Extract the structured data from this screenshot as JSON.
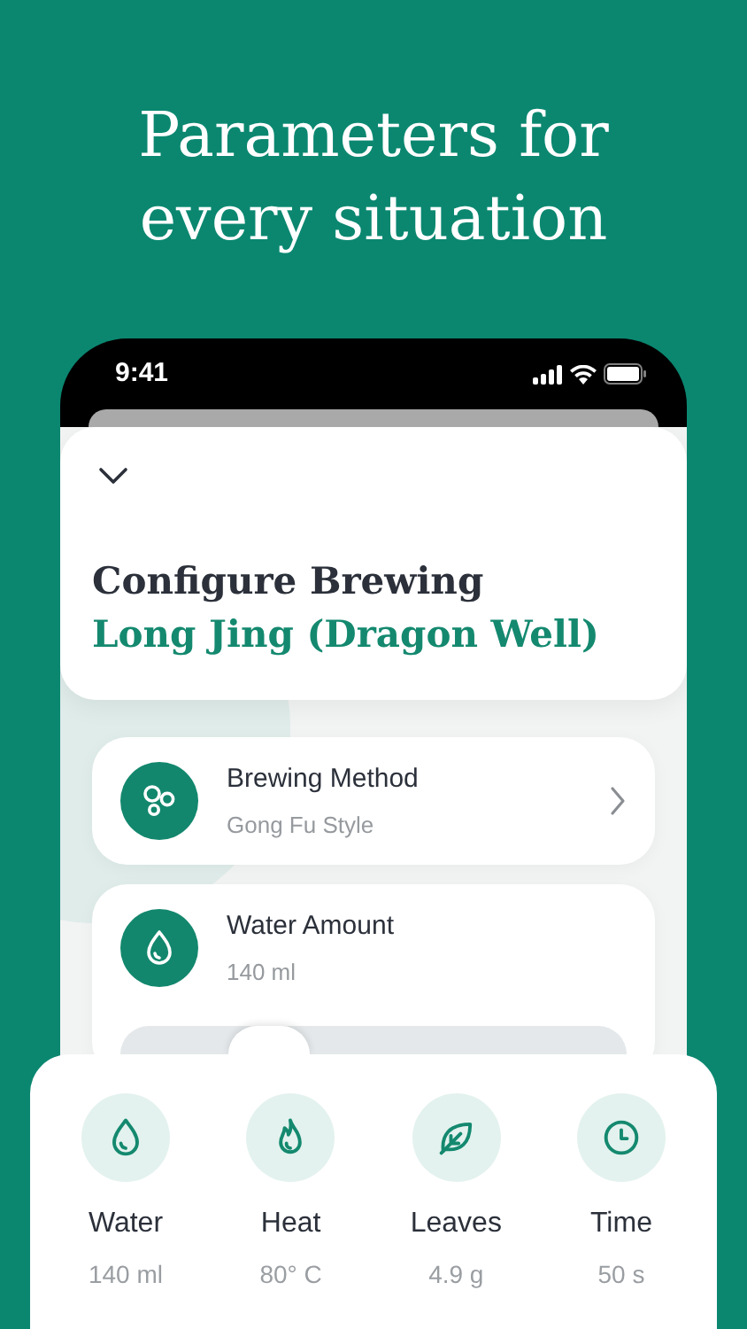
{
  "headline": "Parameters for every situation",
  "status_bar": {
    "time": "9:41"
  },
  "header": {
    "title": "Configure Brewing",
    "subtitle": "Long Jing (Dragon Well)"
  },
  "settings": [
    {
      "kind": "method",
      "label": "Brewing Method",
      "value": "Gong Fu Style",
      "chevron": true
    },
    {
      "kind": "water",
      "label": "Water Amount",
      "value": "140 ml",
      "chevron": false,
      "level": 0.25
    }
  ],
  "summary": [
    {
      "kind": "water",
      "label": "Water",
      "value": "140 ml"
    },
    {
      "kind": "heat",
      "label": "Heat",
      "value": "80° C"
    },
    {
      "kind": "leaves",
      "label": "Leaves",
      "value": "4.9 g"
    },
    {
      "kind": "time",
      "label": "Time",
      "value": "50 s"
    }
  ]
}
